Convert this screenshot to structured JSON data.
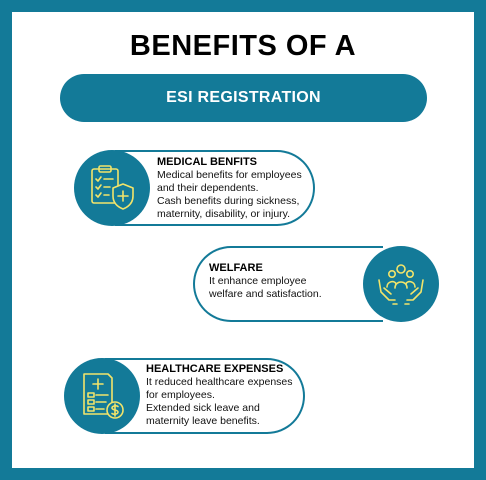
{
  "title": "BENEFITS OF A",
  "banner": "ESI REGISTRATION",
  "cards": [
    {
      "title": "MEDICAL BENFITS",
      "lines": [
        "Medical benefits for employees",
        "and their dependents.",
        "Cash benefits during sickness,",
        "maternity, disability, or injury."
      ],
      "icon": "medical-clipboard-shield-icon"
    },
    {
      "title": "WELFARE",
      "lines": [
        "It enhance employee",
        "welfare and satisfaction."
      ],
      "icon": "hands-people-icon"
    },
    {
      "title": "HEALTHCARE EXPENSES",
      "lines": [
        "It reduced healthcare expenses",
        "for employees.",
        "Extended sick leave and",
        "maternity leave benefits."
      ],
      "icon": "medical-bill-dollar-icon"
    }
  ],
  "colors": {
    "primary": "#137a98",
    "icon_accent": "#f2e46a",
    "text": "#111111",
    "background": "#ffffff"
  }
}
